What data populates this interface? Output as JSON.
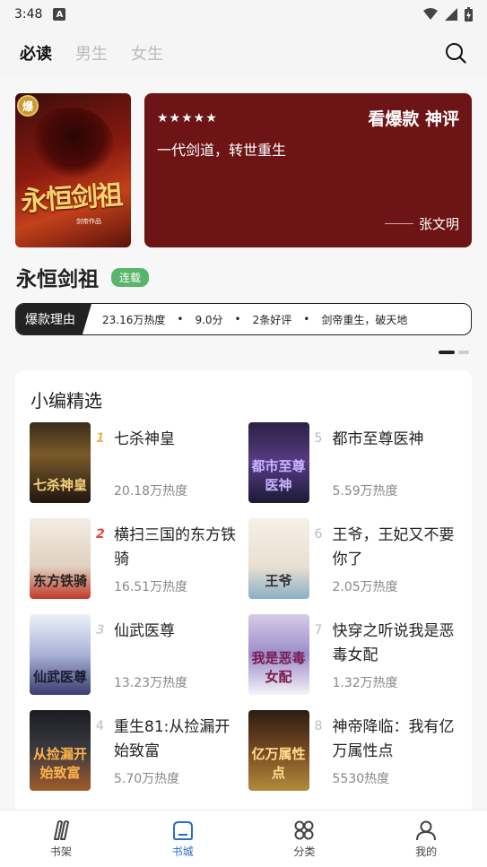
{
  "status": {
    "time": "3:48",
    "notif_letter": "A"
  },
  "header": {
    "tabs": [
      {
        "label": "必读",
        "active": true
      },
      {
        "label": "男生",
        "active": false
      },
      {
        "label": "女生",
        "active": false
      }
    ]
  },
  "hero": {
    "cover_badge": "爆",
    "cover_title": "永恒剑祖",
    "cover_sub": "剑帝作品",
    "stars": "★★★★★",
    "card_title": "看爆款 神评",
    "quote": "一代剑道，转世重生",
    "author": "张文明",
    "book_title": "永恒剑祖",
    "book_status": "连载",
    "reason_label": "爆款理由",
    "reason_items": [
      "23.16万热度",
      "9.0分",
      "2条好评",
      "剑帝重生，破天地"
    ]
  },
  "editor": {
    "title": "小编精选",
    "books": [
      {
        "rank": "1",
        "name": "七杀神皇",
        "heat": "20.18万热度",
        "cover_text": "七杀神皇"
      },
      {
        "rank": "5",
        "name": "都市至尊医神",
        "heat": "5.59万热度",
        "cover_text": "都市至尊医神"
      },
      {
        "rank": "2",
        "name": "横扫三国的东方铁骑",
        "heat": "16.51万热度",
        "cover_text": "东方铁骑"
      },
      {
        "rank": "6",
        "name": "王爷，王妃又不要你了",
        "heat": "2.05万热度",
        "cover_text": "王爷"
      },
      {
        "rank": "3",
        "name": "仙武医尊",
        "heat": "13.23万热度",
        "cover_text": "仙武医尊"
      },
      {
        "rank": "7",
        "name": "快穿之听说我是恶毒女配",
        "heat": "1.32万热度",
        "cover_text": "我是恶毒女配"
      },
      {
        "rank": "4",
        "name": "重生81:从捡漏开始致富",
        "heat": "5.70万热度",
        "cover_text": "从捡漏开始致富"
      },
      {
        "rank": "8",
        "name": "神帝降临：我有亿万属性点",
        "heat": "5530热度",
        "cover_text": "亿万属性点"
      }
    ]
  },
  "tabbar": {
    "items": [
      {
        "label": "书架",
        "icon": "bookshelf-icon"
      },
      {
        "label": "书城",
        "icon": "store-icon",
        "active": true
      },
      {
        "label": "分类",
        "icon": "category-icon"
      },
      {
        "label": "我的",
        "icon": "profile-icon"
      }
    ]
  },
  "colors": {
    "hero_card_bg": "#6d1416",
    "status_pill": "#59b56c",
    "tab_active": "#2b6cc4",
    "rank_gold": "#e8b74a",
    "rank_red": "#e2483d"
  }
}
